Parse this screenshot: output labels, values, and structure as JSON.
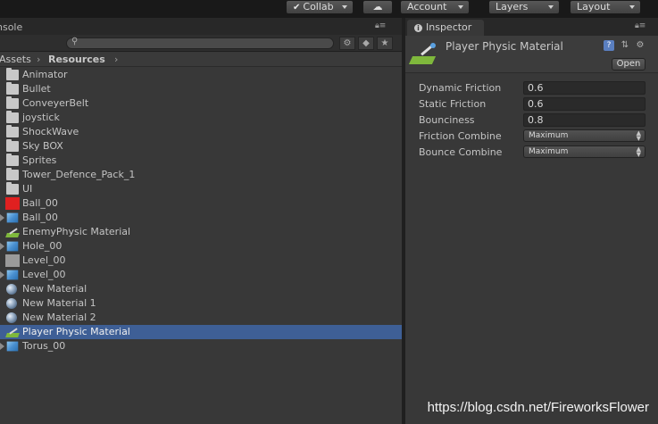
{
  "toolbar": {
    "collab": "Collab",
    "account": "Account",
    "layers": "Layers",
    "layout": "Layout"
  },
  "project": {
    "tab_label": "nsole",
    "search": {
      "placeholder": ""
    },
    "breadcrumb": {
      "root": "Assets",
      "current": "Resources"
    },
    "items": [
      {
        "label": "Animator",
        "icon": "folder-icon"
      },
      {
        "label": "Bullet",
        "icon": "folder-icon"
      },
      {
        "label": "ConveyerBelt",
        "icon": "folder-icon"
      },
      {
        "label": "joystick",
        "icon": "folder-icon"
      },
      {
        "label": "ShockWave",
        "icon": "folder-icon"
      },
      {
        "label": "Sky BOX",
        "icon": "folder-icon"
      },
      {
        "label": "Sprites",
        "icon": "folder-icon"
      },
      {
        "label": "Tower_Defence_Pack_1",
        "icon": "folder-icon"
      },
      {
        "label": "UI",
        "icon": "folder-icon"
      },
      {
        "label": "Ball_00",
        "icon": "red-texture-icon"
      },
      {
        "label": "Ball_00",
        "icon": "prefab-icon"
      },
      {
        "label": "EnemyPhysic Material",
        "icon": "physic-material-icon"
      },
      {
        "label": "Hole_00",
        "icon": "prefab-icon"
      },
      {
        "label": "Level_00",
        "icon": "gray-texture-icon"
      },
      {
        "label": "Level_00",
        "icon": "prefab-icon"
      },
      {
        "label": "New Material",
        "icon": "material-sphere-icon"
      },
      {
        "label": "New Material 1",
        "icon": "material-sphere-icon"
      },
      {
        "label": "New Material 2",
        "icon": "material-sphere-icon"
      },
      {
        "label": "Player Physic Material",
        "icon": "physic-material-icon",
        "selected": true
      },
      {
        "label": "Torus_00",
        "icon": "prefab-icon"
      }
    ]
  },
  "inspector": {
    "tab_label": "Inspector",
    "title": "Player Physic Material",
    "open_button": "Open",
    "properties": {
      "dynamic_friction": {
        "label": "Dynamic Friction",
        "value": "0.6"
      },
      "static_friction": {
        "label": "Static Friction",
        "value": "0.6"
      },
      "bounciness": {
        "label": "Bounciness",
        "value": "0.8"
      },
      "friction_combine": {
        "label": "Friction Combine",
        "value": "Maximum"
      },
      "bounce_combine": {
        "label": "Bounce Combine",
        "value": "Maximum"
      }
    }
  },
  "colors": {
    "selection": "#3e5f96",
    "panel": "#383838",
    "background": "#282828",
    "red_texture": "#e02020",
    "gray_texture": "#9a9a9a"
  },
  "watermark": "https://blog.csdn.net/FireworksFlower"
}
